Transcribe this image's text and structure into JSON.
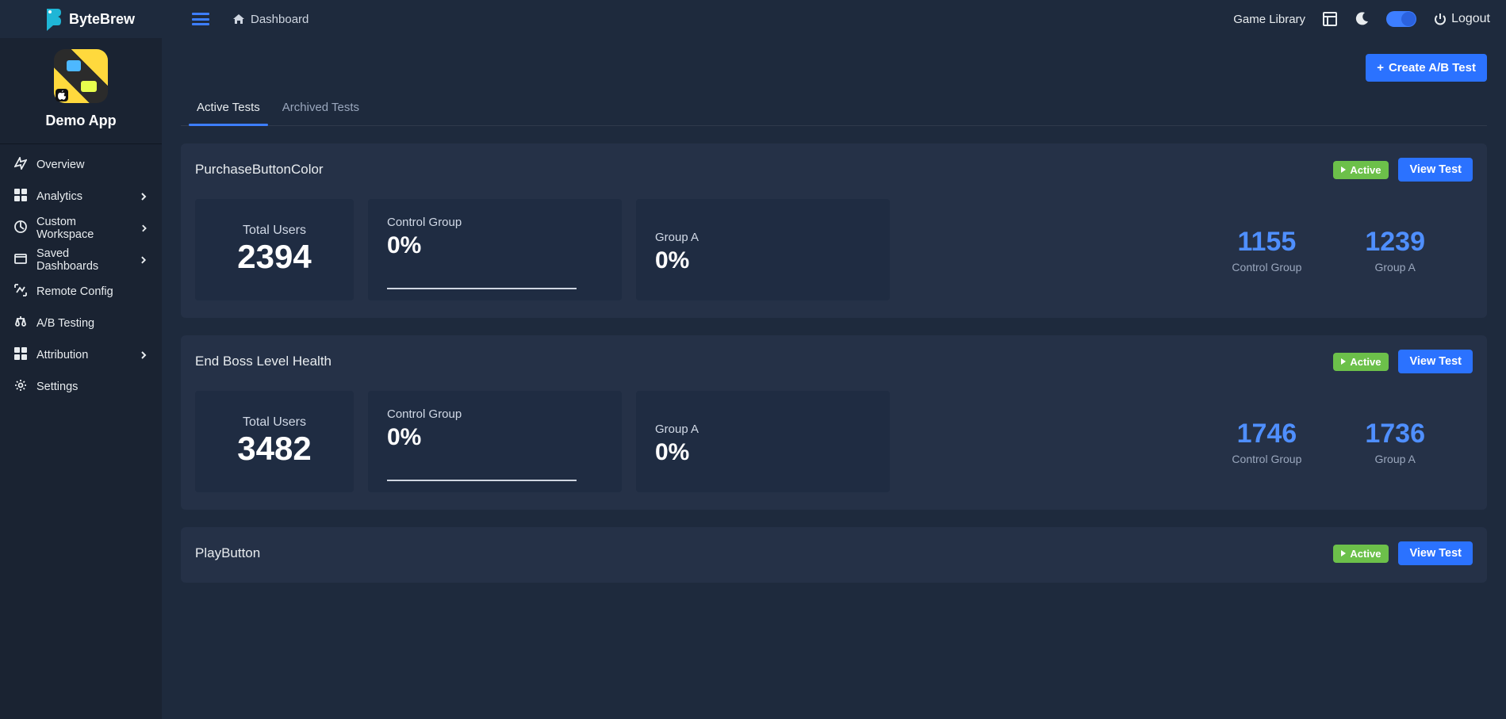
{
  "brand": "ByteBrew",
  "header": {
    "breadcrumb": "Dashboard",
    "game_library": "Game Library",
    "logout": "Logout"
  },
  "app": {
    "name": "Demo App"
  },
  "sidebar": [
    {
      "id": "overview",
      "label": "Overview",
      "expandable": false
    },
    {
      "id": "analytics",
      "label": "Analytics",
      "expandable": true
    },
    {
      "id": "custom-workspace",
      "label": "Custom Workspace",
      "expandable": true
    },
    {
      "id": "saved-dashboards",
      "label": "Saved Dashboards",
      "expandable": true
    },
    {
      "id": "remote-config",
      "label": "Remote Config",
      "expandable": false
    },
    {
      "id": "ab-testing",
      "label": "A/B Testing",
      "expandable": false
    },
    {
      "id": "attribution",
      "label": "Attribution",
      "expandable": true
    },
    {
      "id": "settings",
      "label": "Settings",
      "expandable": false
    }
  ],
  "actions": {
    "create_test": "Create A/B Test"
  },
  "tabs": {
    "active": "Active Tests",
    "archived": "Archived Tests",
    "selected": "active"
  },
  "labels": {
    "total_users": "Total Users",
    "control_group": "Control Group",
    "group_a": "Group A",
    "status_active": "Active",
    "view_test": "View Test"
  },
  "tests": [
    {
      "name": "PurchaseButtonColor",
      "total_users": "2394",
      "control_pct": "0%",
      "group_a_pct": "0%",
      "control_count": "1155",
      "group_a_count": "1239"
    },
    {
      "name": "End Boss Level Health",
      "total_users": "3482",
      "control_pct": "0%",
      "group_a_pct": "0%",
      "control_count": "1746",
      "group_a_count": "1736"
    },
    {
      "name": "PlayButton",
      "total_users": "",
      "control_pct": "",
      "group_a_pct": "",
      "control_count": "",
      "group_a_count": ""
    }
  ],
  "colors": {
    "accent": "#2b72ff",
    "success": "#6cc04a",
    "stat": "#4f8fff"
  }
}
